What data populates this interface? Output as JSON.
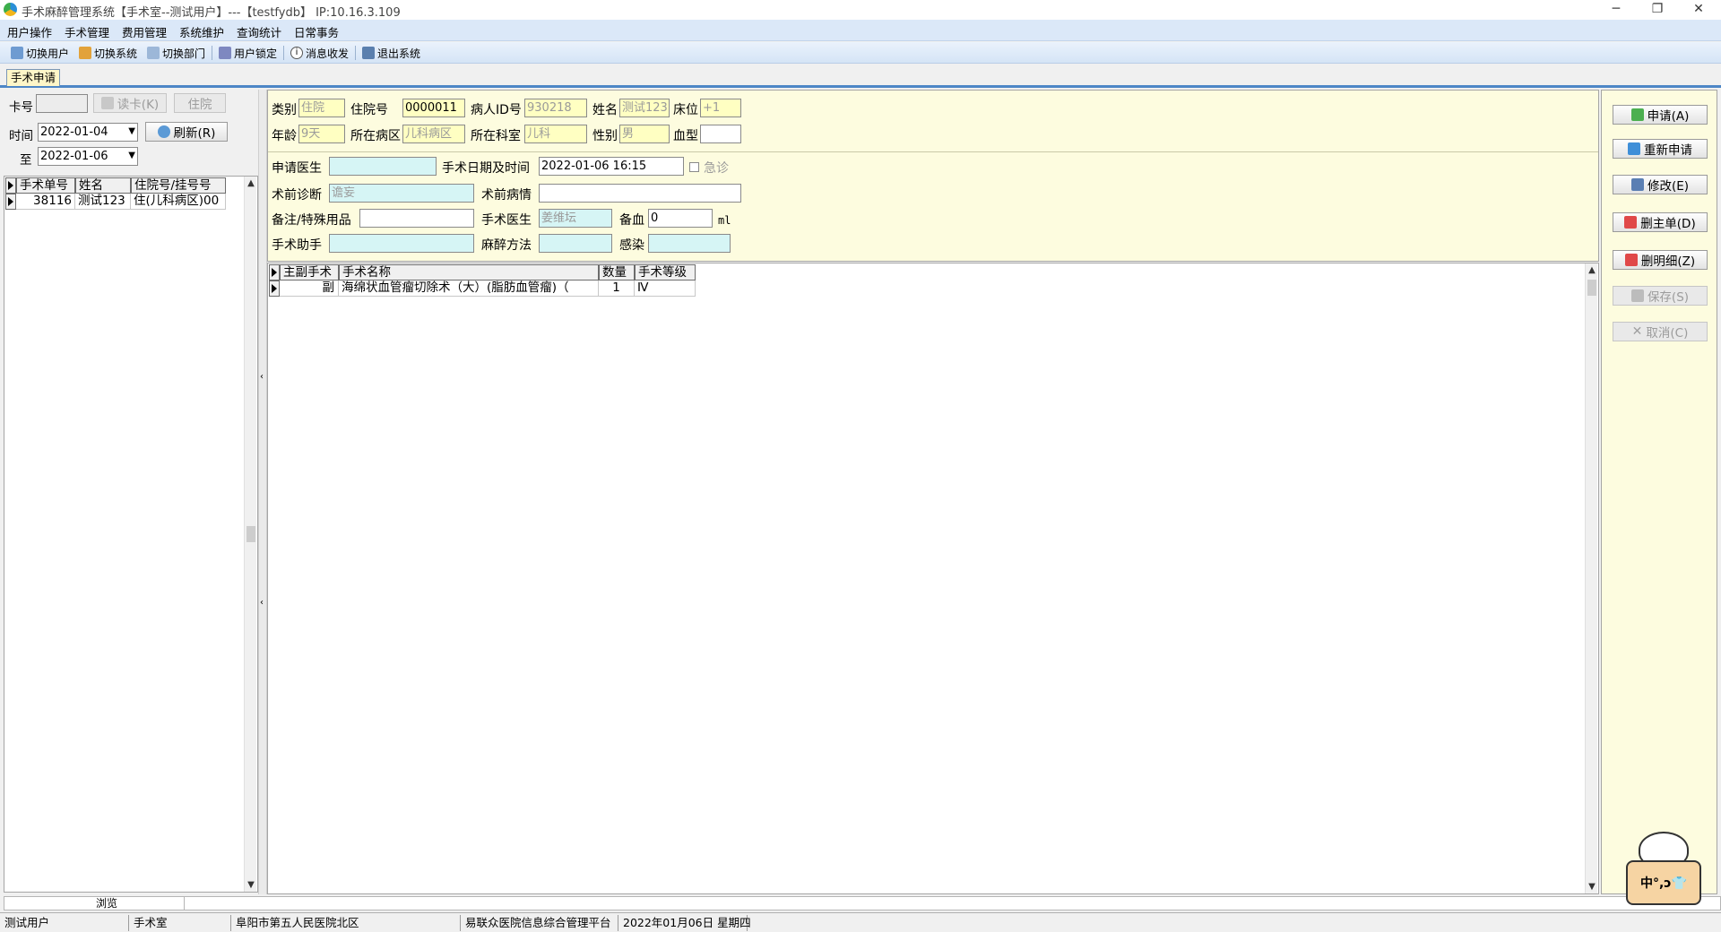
{
  "window": {
    "title": "手术麻醉管理系统【手术室--测试用户】---【testfydb】 IP:10.16.3.109",
    "controls": {
      "minimize": "─",
      "restore": "❐",
      "close": "✕"
    }
  },
  "menu": [
    "用户操作",
    "手术管理",
    "费用管理",
    "系统维护",
    "查询统计",
    "日常事务"
  ],
  "toolbar": {
    "switch_user": "切换用户",
    "switch_system": "切换系统",
    "switch_dept": "切换部门",
    "user_lock": "用户锁定",
    "messages": "消息收发",
    "exit": "退出系统"
  },
  "tab": {
    "active": "手术申请"
  },
  "left": {
    "card_label": "卡号",
    "card_value": "",
    "read_card_btn": "读卡(K)",
    "inpatient_btn": "住院",
    "time_label": "时间",
    "date_from": "2022-01-04",
    "to_label": "至",
    "date_to": "2022-01-06",
    "refresh_btn": "刷新(R)",
    "columns": [
      "手术单号",
      "姓名",
      "住院号/挂号号"
    ],
    "rows": [
      {
        "no": "38116",
        "name": "测试123",
        "reg": "住(儿科病区)00"
      }
    ],
    "browse_label": "浏览"
  },
  "form": {
    "type_label": "类别",
    "type_value": "住院",
    "inpatient_no_label": "住院号",
    "inpatient_no_value": "0000011",
    "patient_id_label": "病人ID号",
    "patient_id_value": "930218",
    "name_label": "姓名",
    "name_value": "测试123",
    "bed_label": "床位",
    "bed_value": "+1",
    "age_label": "年龄",
    "age_value": "9天",
    "ward_label": "所在病区",
    "ward_value": "儿科病区",
    "dept_label": "所在科室",
    "dept_value": "儿科",
    "sex_label": "性别",
    "sex_value": "男",
    "blood_label": "血型",
    "blood_value": "",
    "doctor_label": "申请医生",
    "doctor_value": "",
    "datetime_label": "手术日期及时间",
    "datetime_value": "2022-01-06 16:15",
    "urgent_label": "急诊",
    "pre_diag_label": "术前诊断",
    "pre_diag_value": "谵妄",
    "pre_cond_label": "术前病情",
    "pre_cond_value": "",
    "notes_label": "备注/特殊用品",
    "notes_value": "",
    "surgeon_label": "手术医生",
    "surgeon_value": "姜维坛",
    "blood_prep_label": "备血",
    "blood_prep_value": "0",
    "blood_unit": "ml",
    "assistant_label": "手术助手",
    "assistant_value": "",
    "anesthesia_label": "麻醉方法",
    "anesthesia_value": "",
    "infection_label": "感染",
    "infection_value": ""
  },
  "surgery_grid": {
    "columns": [
      "主副手术",
      "手术名称",
      "数量",
      "手术等级"
    ],
    "rows": [
      {
        "role": "副",
        "name": "海绵状血管瘤切除术（大）(脂肪血管瘤)（",
        "qty": "1",
        "level": "Ⅳ"
      }
    ]
  },
  "actions": {
    "apply": "申请(A)",
    "reapply": "重新申请",
    "modify": "修改(E)",
    "delete_main": "删主单(D)",
    "delete_detail": "删明细(Z)",
    "save": "保存(S)",
    "cancel": "取消(C)"
  },
  "ime": {
    "text": "中°,ↄ👕"
  },
  "status": {
    "user": "测试用户",
    "dept": "手术室",
    "hospital": "阜阳市第五人民医院北区",
    "platform": "易联众医院信息综合管理平台",
    "date": "2022年01月06日 星期四"
  }
}
